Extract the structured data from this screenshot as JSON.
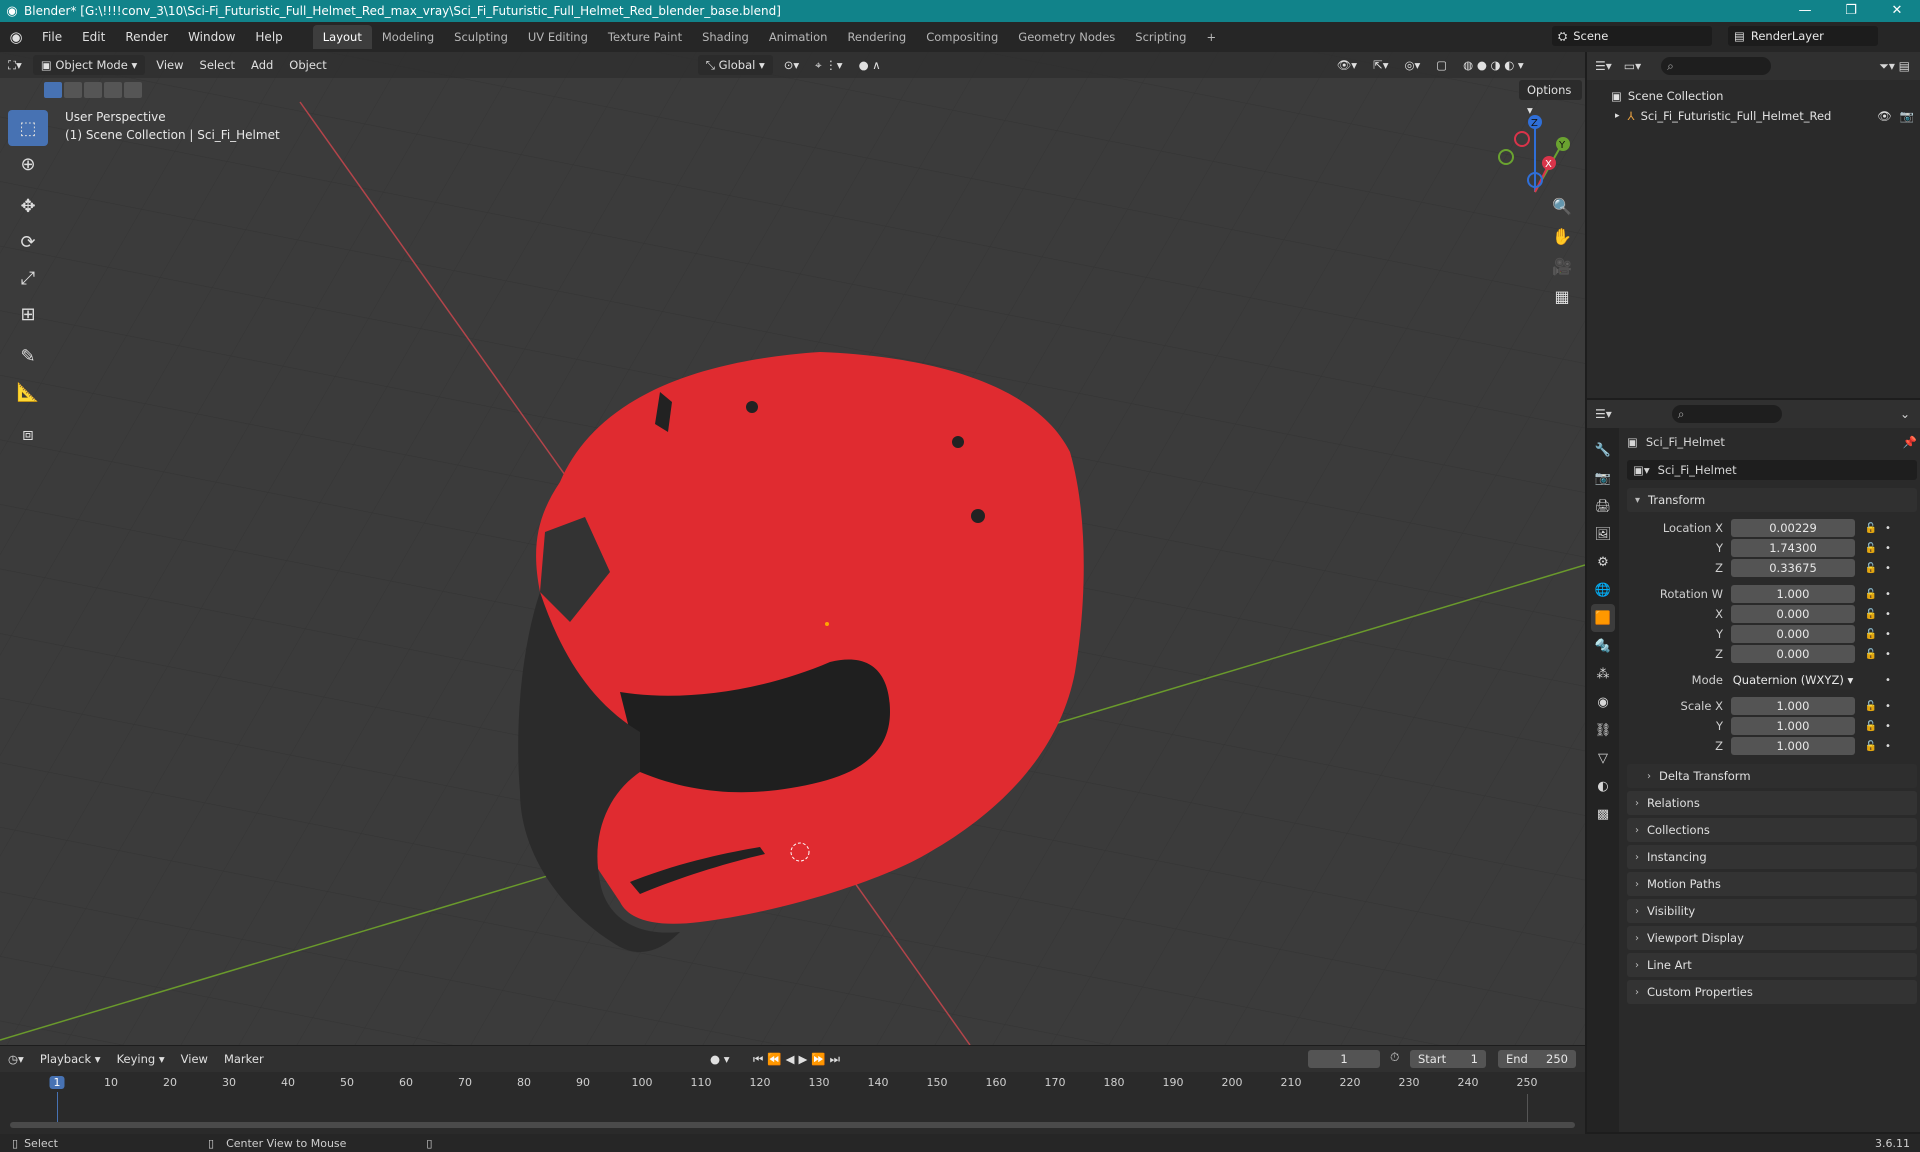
{
  "window": {
    "title": "Blender* [G:\\!!!!conv_3\\10\\Sci-Fi_Futuristic_Full_Helmet_Red_max_vray\\Sci_Fi_Futuristic_Full_Helmet_Red_blender_base.blend]",
    "min": "—",
    "max": "❐",
    "close": "✕"
  },
  "menu": [
    "File",
    "Edit",
    "Render",
    "Window",
    "Help"
  ],
  "workspaces": [
    "Layout",
    "Modeling",
    "Sculpting",
    "UV Editing",
    "Texture Paint",
    "Shading",
    "Animation",
    "Rendering",
    "Compositing",
    "Geometry Nodes",
    "Scripting"
  ],
  "workspace_add": "+",
  "scene": "Scene",
  "render_layer": "RenderLayer",
  "viewport": {
    "mode": "Object Mode",
    "menus": [
      "View",
      "Select",
      "Add",
      "Object"
    ],
    "orientation": "Global",
    "options": "Options",
    "perspective": "User Perspective",
    "collection_info": "(1) Scene Collection | Sci_Fi_Helmet",
    "gizmo": {
      "x": "X",
      "y": "Y",
      "z": "Z"
    }
  },
  "outliner": {
    "root": "Scene Collection",
    "item": "Sci_Fi_Futuristic_Full_Helmet_Red"
  },
  "properties": {
    "object_name": "Sci_Fi_Helmet",
    "data_name": "Sci_Fi_Helmet",
    "transform_title": "Transform",
    "location": {
      "label": "Location X",
      "x": "0.00229",
      "y": "1.74300",
      "z": "0.33675"
    },
    "rotation": {
      "label": "Rotation W",
      "w": "1.000",
      "x": "0.000",
      "y": "0.000",
      "z": "0.000"
    },
    "mode_label": "Mode",
    "mode_value": "Quaternion (WXYZ)",
    "scale": {
      "label": "Scale X",
      "x": "1.000",
      "y": "1.000",
      "z": "1.000"
    },
    "axis": {
      "y": "Y",
      "z": "Z",
      "x": "X"
    },
    "delta": "Delta Transform",
    "panels": [
      "Relations",
      "Collections",
      "Instancing",
      "Motion Paths",
      "Visibility",
      "Viewport Display",
      "Line Art",
      "Custom Properties"
    ]
  },
  "timeline": {
    "menus": [
      "Playback",
      "Keying",
      "View",
      "Marker"
    ],
    "current_frame": "1",
    "start_label": "Start",
    "start": "1",
    "end_label": "End",
    "end": "250",
    "ticks": [
      "1",
      "10",
      "20",
      "30",
      "40",
      "50",
      "60",
      "70",
      "80",
      "90",
      "100",
      "110",
      "120",
      "130",
      "140",
      "150",
      "160",
      "170",
      "180",
      "190",
      "200",
      "210",
      "220",
      "230",
      "240",
      "250"
    ]
  },
  "status": {
    "select": "Select",
    "center": "Center View to Mouse",
    "version": "3.6.11"
  },
  "colors": {
    "accent": "#4772b3",
    "titlebar": "#11838a",
    "helmet": "#e02b30"
  }
}
